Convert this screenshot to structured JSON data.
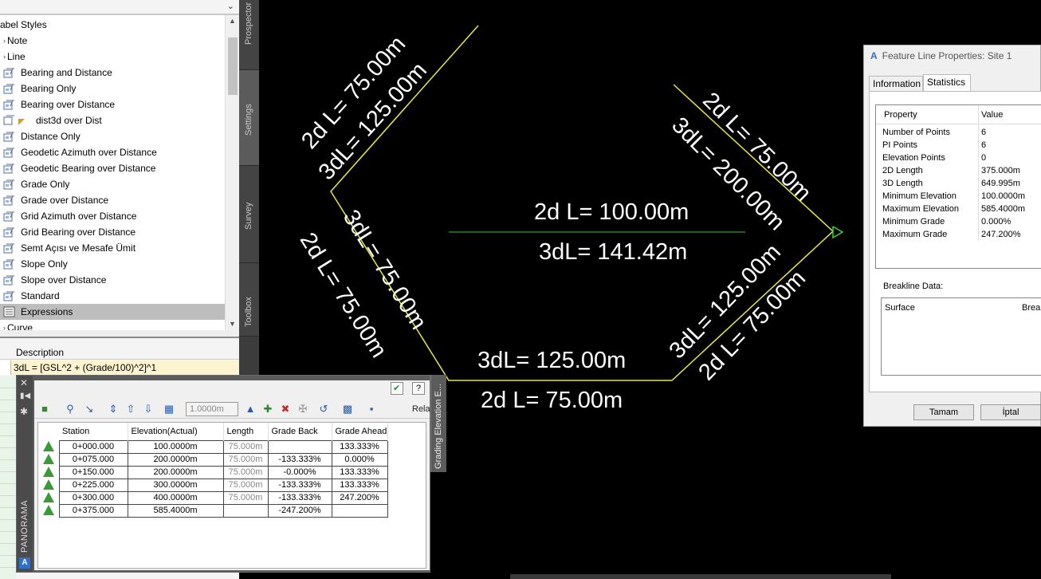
{
  "tree": {
    "header_label": "abel Styles",
    "items": [
      {
        "label": "Note",
        "kind": "folder"
      },
      {
        "label": "Line",
        "kind": "folder"
      },
      {
        "label": "Bearing and Distance",
        "kind": "style"
      },
      {
        "label": "Bearing Only",
        "kind": "style"
      },
      {
        "label": "Bearing over Distance",
        "kind": "style"
      },
      {
        "label": "dist3d over Dist",
        "kind": "style-child"
      },
      {
        "label": "Distance Only",
        "kind": "style"
      },
      {
        "label": "Geodetic Azimuth over Distance",
        "kind": "style"
      },
      {
        "label": "Geodetic Bearing over Distance",
        "kind": "style"
      },
      {
        "label": "Grade Only",
        "kind": "style"
      },
      {
        "label": "Grade over Distance",
        "kind": "style"
      },
      {
        "label": "Grid Azimuth over Distance",
        "kind": "style"
      },
      {
        "label": "Grid Bearing over Distance",
        "kind": "style"
      },
      {
        "label": "Semt Açısı ve Mesafe Ümit",
        "kind": "style"
      },
      {
        "label": "Slope Only",
        "kind": "style"
      },
      {
        "label": "Slope over Distance",
        "kind": "style"
      },
      {
        "label": "Standard",
        "kind": "style"
      },
      {
        "label": "Expressions",
        "kind": "expressions"
      },
      {
        "label": "Curve",
        "kind": "folder"
      }
    ]
  },
  "side_tabs": [
    "Prospector",
    "Settings",
    "Survey",
    "Toolbox"
  ],
  "description_panel": {
    "header": "Description",
    "row": "3dL = [GSL^2 + (Grade/100)^2]^1"
  },
  "panorama": {
    "label": "PANORAMA",
    "side_tab": "Grading Elevation E...",
    "elevation_value": "1.0000m",
    "toolbar_trailing": "Rela",
    "columns": [
      "Station",
      "Elevation(Actual)",
      "Length",
      "Grade Back",
      "Grade Ahead"
    ],
    "rows": [
      {
        "station": "0+000.000",
        "elevation": "100.0000m",
        "length": "75.000m",
        "grade_back": "",
        "grade_ahead": "133.333%"
      },
      {
        "station": "0+075.000",
        "elevation": "200.0000m",
        "length": "75.000m",
        "grade_back": "-133.333%",
        "grade_ahead": "0.000%"
      },
      {
        "station": "0+150.000",
        "elevation": "200.0000m",
        "length": "75.000m",
        "grade_back": "-0.000%",
        "grade_ahead": "133.333%"
      },
      {
        "station": "0+225.000",
        "elevation": "300.0000m",
        "length": "75.000m",
        "grade_back": "-133.333%",
        "grade_ahead": "133.333%"
      },
      {
        "station": "0+300.000",
        "elevation": "400.0000m",
        "length": "75.000m",
        "grade_back": "-133.333%",
        "grade_ahead": "247.200%"
      },
      {
        "station": "0+375.000",
        "elevation": "585.4000m",
        "length": "",
        "grade_back": "-247.200%",
        "grade_ahead": ""
      }
    ]
  },
  "drawing": {
    "labels": {
      "top_left_2d": "2d L= 75.00m",
      "top_left_3d": "3dL= 125.00m",
      "left_3d": "3dL= 75.00m",
      "left_2d": "2d L= 75.00m",
      "bottom_3d": "3dL= 125.00m",
      "bottom_2d": "2d L= 75.00m",
      "center_2d": "2d L= 100.00m",
      "center_3d": "3dL= 141.42m",
      "top_right_2d": "2d L= 75.00m",
      "top_right_3d": "3dL= 200.00m",
      "bottom_right_3d": "3dL= 125.00m",
      "bottom_right_2d": "2d L= 75.00m"
    },
    "colors": {
      "feature_line": "#e8e83a",
      "center_line": "#2f9e2f",
      "marker": "#3ad23a",
      "label": "#ffffff"
    }
  },
  "dialog": {
    "title": "Feature Line Properties: Site 1",
    "tabs": [
      "Information",
      "Statistics"
    ],
    "active_tab": "Statistics",
    "prop_header": {
      "property": "Property",
      "value": "Value"
    },
    "properties": [
      {
        "key": "Number of Points",
        "value": "6"
      },
      {
        "key": "PI Points",
        "value": "6"
      },
      {
        "key": "Elevation Points",
        "value": "0"
      },
      {
        "key": "2D Length",
        "value": "375.000m"
      },
      {
        "key": "3D Length",
        "value": "649.995m"
      },
      {
        "key": "Minimum Elevation",
        "value": "100.0000m"
      },
      {
        "key": "Maximum Elevation",
        "value": "585.4000m"
      },
      {
        "key": "Minimum Grade",
        "value": "0.000%"
      },
      {
        "key": "Maximum Grade",
        "value": "247.200%"
      }
    ],
    "breakline_label": "Breakline Data:",
    "breakline_columns": [
      "Surface",
      "Break"
    ],
    "ok_button": "Tamam",
    "cancel_button": "İptal"
  }
}
